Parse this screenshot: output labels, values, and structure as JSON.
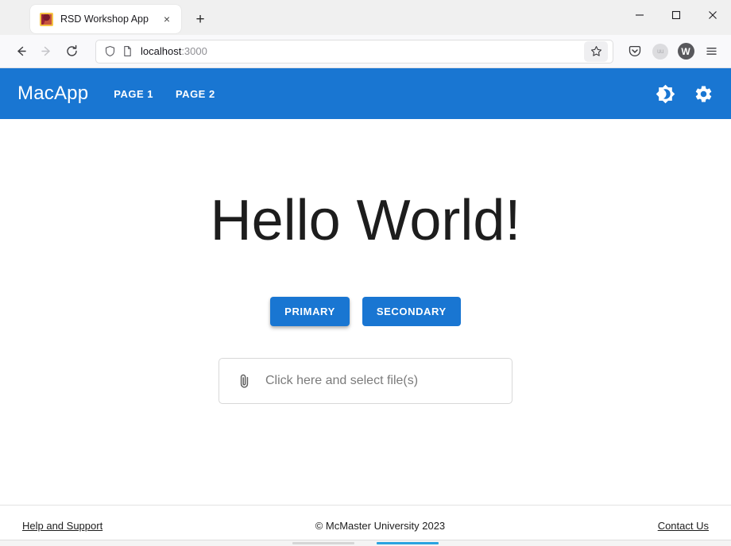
{
  "browser": {
    "tab": {
      "title": "RSD Workshop App",
      "favicon_name": "mcmaster-crest-favicon",
      "close_label": "×"
    },
    "new_tab_label": "+",
    "window_controls": {
      "minimize": "—",
      "maximize": "☐",
      "close": "✕"
    },
    "toolbar": {
      "back_label": "←",
      "forward_label": "→",
      "reload_label": "⟳",
      "shield_icon": "shield-icon",
      "page_icon": "page-icon",
      "url_host": "localhost",
      "url_port": ":3000",
      "bookmark_icon": "star-icon",
      "pocket_icon": "pocket-icon",
      "account_avatar_label": "uu",
      "extension_avatar_label": "W",
      "menu_label": "☰"
    }
  },
  "app": {
    "appbar": {
      "brand": "MacApp",
      "nav_links": [
        {
          "label": "PAGE 1",
          "name": "nav-link-page-1"
        },
        {
          "label": "PAGE 2",
          "name": "nav-link-page-2"
        }
      ],
      "theme_toggle_icon": "brightness-dark-mode-icon",
      "settings_icon": "gear-icon",
      "background_color": "#1976d2",
      "text_color": "#ffffff"
    },
    "main": {
      "heading": "Hello World!",
      "buttons": [
        {
          "label": "PRIMARY",
          "name": "primary-button",
          "elevated": true
        },
        {
          "label": "SECONDARY",
          "name": "secondary-button",
          "elevated": false
        }
      ],
      "file_upload": {
        "icon": "paperclip-icon",
        "placeholder": "Click here and select file(s)"
      },
      "accent_color": "#1976d2"
    },
    "footer": {
      "left_link": "Help and Support",
      "center_text": "© McMaster University 2023",
      "right_link": "Contact Us"
    }
  }
}
